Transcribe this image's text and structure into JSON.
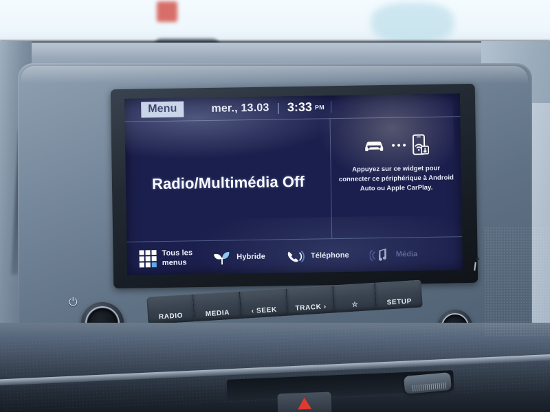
{
  "scene": {
    "description": "Car dashboard infotainment head unit photo"
  },
  "screen": {
    "statusbar": {
      "menu_label": "Menu",
      "date": "mer., 13.03",
      "time": "3:33",
      "ampm": "PM"
    },
    "main": {
      "left_status": "Radio/Multimédia Off",
      "widget": {
        "icons": [
          "car-icon",
          "ellipsis-icon",
          "smartphone-connect-icon"
        ],
        "text": "Appuyez sur ce widget pour connecter ce périphérique à Android Auto ou Apple CarPlay."
      }
    },
    "dock": [
      {
        "label": "Tous les\nmenus",
        "label_line1": "Tous les",
        "label_line2": "menus",
        "icon": "grid-icon",
        "disabled": false
      },
      {
        "label": "Hybride",
        "icon": "leaf-sprout-icon",
        "disabled": false
      },
      {
        "label": "Téléphone",
        "icon": "phone-icon",
        "disabled": false
      },
      {
        "label": "Média",
        "icon": "music-note-icon",
        "disabled": true
      }
    ]
  },
  "hardware": {
    "buttons": [
      {
        "label": "RADIO",
        "name": "radio-button"
      },
      {
        "label": "MEDIA",
        "name": "media-button"
      },
      {
        "label": "‹ SEEK",
        "name": "seek-button"
      },
      {
        "label": "TRACK ›",
        "name": "track-button"
      },
      {
        "label": "☆",
        "name": "favorites-button"
      },
      {
        "label": "SETUP",
        "name": "setup-button"
      }
    ],
    "left_knob": {
      "name": "power-volume-knob",
      "glyph": "⏻"
    },
    "right_knob": {
      "name": "tune-scroll-knob"
    }
  },
  "colors": {
    "screen_background": "#1b1f4d",
    "menu_button_bg": "#c9d4e8",
    "accent_blue": "#5fa8e8",
    "disabled_text": "#5a618f",
    "hazard_red": "#e03a2f"
  }
}
